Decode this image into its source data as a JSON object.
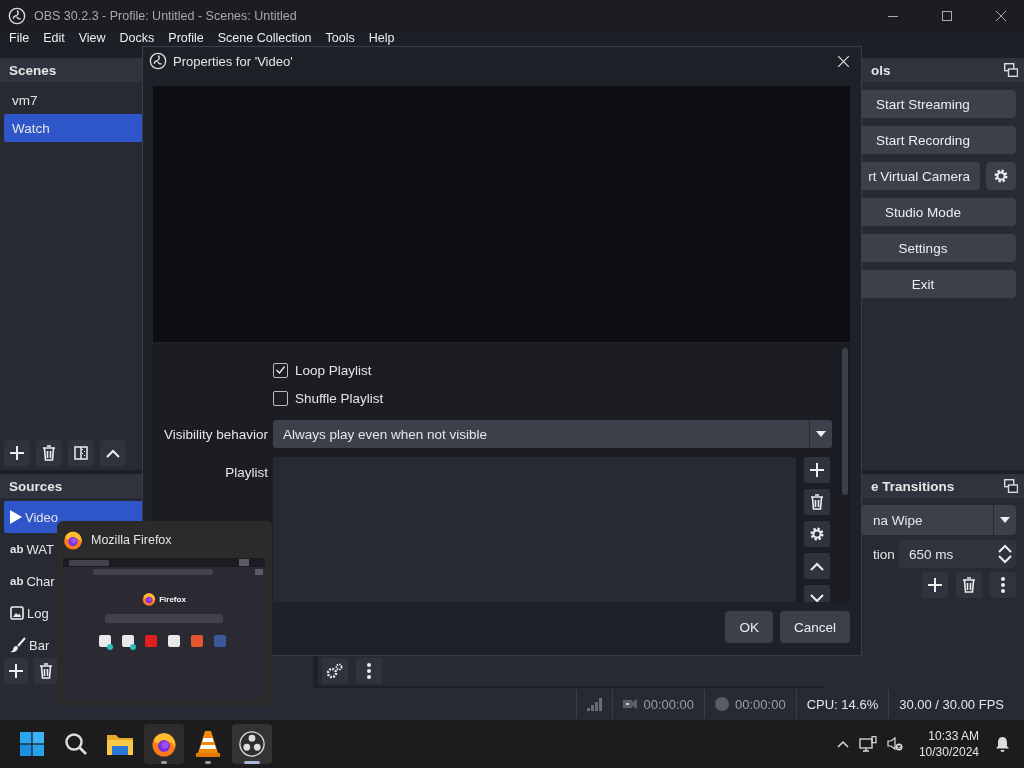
{
  "window": {
    "title": "OBS 30.2.3 - Profile: Untitled - Scenes: Untitled"
  },
  "menu": [
    "File",
    "Edit",
    "View",
    "Docks",
    "Profile",
    "Scene Collection",
    "Tools",
    "Help"
  ],
  "scenes": {
    "title": "Scenes",
    "items": [
      {
        "label": "vm7",
        "selected": false
      },
      {
        "label": "Watch",
        "selected": true
      }
    ]
  },
  "sources": {
    "title": "Sources",
    "items": [
      {
        "kind": "media",
        "label": "Video",
        "selected": true
      },
      {
        "kind": "text",
        "glyph": "ab",
        "label": "WAT",
        "selected": false
      },
      {
        "kind": "text",
        "glyph": "ab",
        "label": "Char",
        "selected": false
      },
      {
        "kind": "image",
        "label": "Log",
        "selected": false
      },
      {
        "kind": "brush",
        "label": "Bar",
        "selected": false
      }
    ]
  },
  "controls": {
    "title": "ols",
    "buttons": [
      {
        "kind": "button",
        "label": "Start Streaming"
      },
      {
        "kind": "button",
        "label": "Start Recording"
      },
      {
        "kind": "split",
        "label": "rt Virtual Camera"
      },
      {
        "kind": "button",
        "label": "Studio Mode"
      },
      {
        "kind": "button",
        "label": "Settings"
      },
      {
        "kind": "button",
        "label": "Exit"
      }
    ]
  },
  "transitions": {
    "title": "e Transitions",
    "transition": "na Wipe",
    "duration_label": "tion",
    "duration": "650 ms"
  },
  "status_bar": {
    "stream_time": "00:00:00",
    "record_time": "00:00:00",
    "cpu": "CPU: 14.6%",
    "fps": "30.00 / 30.00 FPS"
  },
  "dialog": {
    "title": "Properties for 'Video'",
    "checkboxes": [
      {
        "label": "Loop Playlist",
        "checked": true
      },
      {
        "label": "Shuffle Playlist",
        "checked": false
      }
    ],
    "visibility": {
      "label": "Visibility behavior",
      "value": "Always play even when not visible"
    },
    "playlist": {
      "label": "Playlist"
    },
    "buttons": [
      "OK",
      "Cancel"
    ]
  },
  "thumbnail": {
    "title": "Mozilla Firefox",
    "preview_text": "Firefox"
  },
  "taskbar": {
    "apps": [
      {
        "kind": "start",
        "running": false,
        "focused": false,
        "hovered": false
      },
      {
        "kind": "search",
        "running": false,
        "focused": false,
        "hovered": false
      },
      {
        "kind": "files",
        "running": false,
        "focused": false,
        "hovered": false
      },
      {
        "kind": "firefox",
        "running": true,
        "focused": false,
        "hovered": true
      },
      {
        "kind": "vlc",
        "running": true,
        "focused": false,
        "hovered": false
      },
      {
        "kind": "obs",
        "running": true,
        "focused": true,
        "hovered": false
      }
    ],
    "time": "10:33 AM",
    "date": "10/30/2024"
  }
}
